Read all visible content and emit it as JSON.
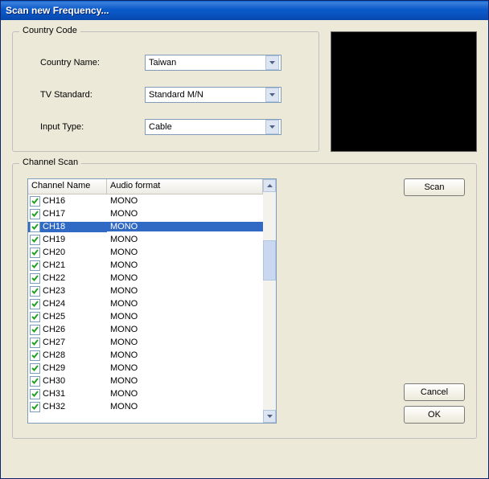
{
  "title": "Scan new Frequency...",
  "countryGroup": {
    "legend": "Country Code",
    "countryNameLabel": "Country Name:",
    "countryNameValue": "Taiwan",
    "tvStandardLabel": "TV Standard:",
    "tvStandardValue": "Standard M/N",
    "inputTypeLabel": "Input Type:",
    "inputTypeValue": "Cable"
  },
  "channelGroup": {
    "legend": "Channel Scan",
    "colChannelName": "Channel Name",
    "colAudioFormat": "Audio format",
    "rows": [
      {
        "checked": true,
        "name": "CH16",
        "audio": "MONO",
        "selected": false
      },
      {
        "checked": true,
        "name": "CH17",
        "audio": "MONO",
        "selected": false
      },
      {
        "checked": true,
        "name": "CH18",
        "audio": "MONO",
        "selected": true
      },
      {
        "checked": true,
        "name": "CH19",
        "audio": "MONO",
        "selected": false
      },
      {
        "checked": true,
        "name": "CH20",
        "audio": "MONO",
        "selected": false
      },
      {
        "checked": true,
        "name": "CH21",
        "audio": "MONO",
        "selected": false
      },
      {
        "checked": true,
        "name": "CH22",
        "audio": "MONO",
        "selected": false
      },
      {
        "checked": true,
        "name": "CH23",
        "audio": "MONO",
        "selected": false
      },
      {
        "checked": true,
        "name": "CH24",
        "audio": "MONO",
        "selected": false
      },
      {
        "checked": true,
        "name": "CH25",
        "audio": "MONO",
        "selected": false
      },
      {
        "checked": true,
        "name": "CH26",
        "audio": "MONO",
        "selected": false
      },
      {
        "checked": true,
        "name": "CH27",
        "audio": "MONO",
        "selected": false
      },
      {
        "checked": true,
        "name": "CH28",
        "audio": "MONO",
        "selected": false
      },
      {
        "checked": true,
        "name": "CH29",
        "audio": "MONO",
        "selected": false
      },
      {
        "checked": true,
        "name": "CH30",
        "audio": "MONO",
        "selected": false
      },
      {
        "checked": true,
        "name": "CH31",
        "audio": "MONO",
        "selected": false
      },
      {
        "checked": true,
        "name": "CH32",
        "audio": "MONO",
        "selected": false
      }
    ]
  },
  "buttons": {
    "scan": "Scan",
    "cancel": "Cancel",
    "ok": "OK"
  }
}
